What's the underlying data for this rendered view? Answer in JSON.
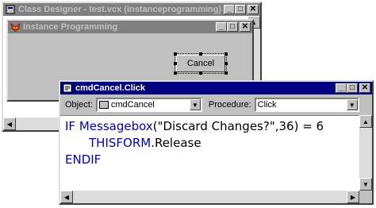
{
  "class_designer": {
    "title": "Class Designer - test.vcx (instanceprogramming)"
  },
  "form": {
    "title": "Instance Programming",
    "cancel_button": "Cancel"
  },
  "code_window": {
    "title": "cmdCancel.Click",
    "object_label": "Object:",
    "object_value": "cmdCancel",
    "procedure_label": "Procedure:",
    "procedure_value": "Click",
    "code": {
      "line1_kw": "IF",
      "line1_fn": "Messagebox",
      "line1_rest": "(\"Discard Changes?\",36) = 6",
      "line2_kw": "THISFORM",
      "line2_rest": ".Release",
      "line3_kw": "ENDIF"
    }
  },
  "window_buttons": {
    "minimize": "_",
    "maximize": "□",
    "close": "✕"
  },
  "colors": {
    "active_title": "#000080",
    "inactive_title": "#808080",
    "keyword": "#0000c0"
  }
}
